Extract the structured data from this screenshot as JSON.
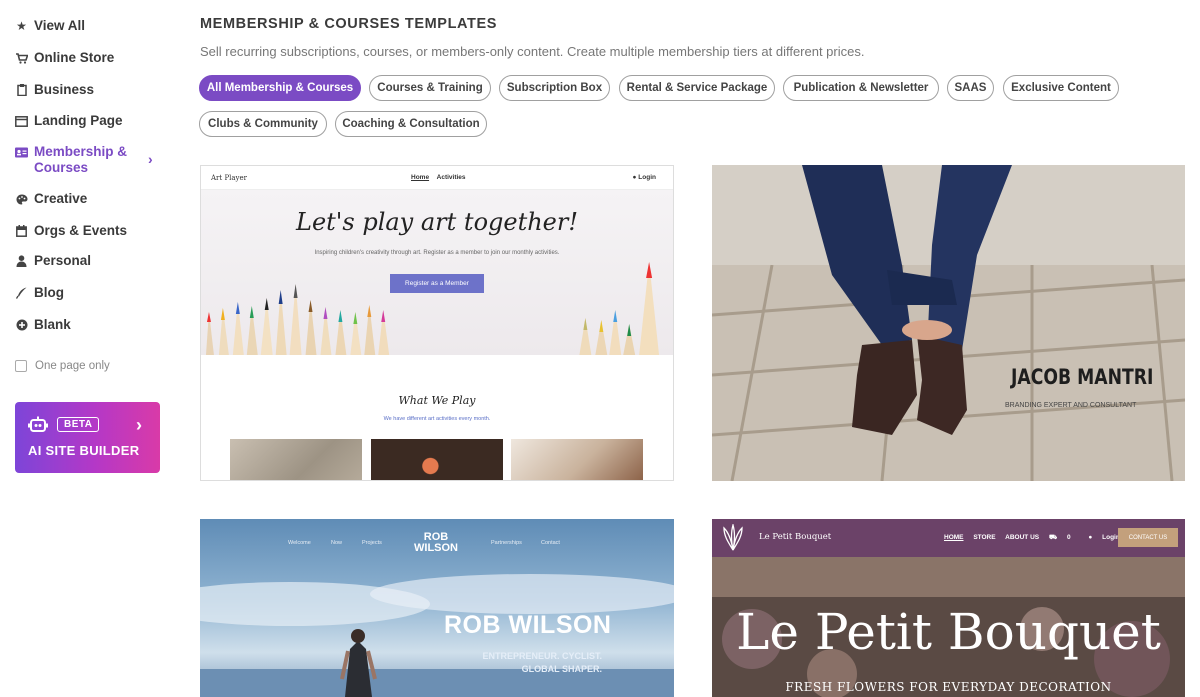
{
  "sidebar": {
    "items": [
      {
        "label": "View All",
        "icon": "star-icon"
      },
      {
        "label": "Online Store",
        "icon": "cart-icon"
      },
      {
        "label": "Business",
        "icon": "clipboard-icon"
      },
      {
        "label": "Landing Page",
        "icon": "browser-window-icon"
      },
      {
        "label": "Membership & Courses",
        "icon": "id-card-icon",
        "active": true
      },
      {
        "label": "Creative",
        "icon": "palette-icon"
      },
      {
        "label": "Orgs & Events",
        "icon": "calendar-icon"
      },
      {
        "label": "Personal",
        "icon": "person-icon"
      },
      {
        "label": "Blog",
        "icon": "quill-icon"
      },
      {
        "label": "Blank",
        "icon": "plus-circle-icon"
      }
    ],
    "one_page_only": "One page only",
    "ai_builder": {
      "badge": "BETA",
      "label": "AI SITE BUILDER"
    }
  },
  "main": {
    "title": "MEMBERSHIP & COURSES TEMPLATES",
    "subtitle": "Sell recurring subscriptions, courses, or members-only content. Create multiple membership tiers at different prices.",
    "filters": [
      "All Membership & Courses",
      "Courses & Training",
      "Subscription Box",
      "Rental & Service Package",
      "Publication & Newsletter",
      "SAAS",
      "Exclusive Content",
      "Clubs & Community",
      "Coaching & Consultation"
    ],
    "active_filter": "All Membership & Courses"
  },
  "templates": {
    "art": {
      "brand": "Art Player",
      "nav_home": "Home",
      "nav_activities": "Activities",
      "login": "Login",
      "headline": "Let's play art together!",
      "subtext": "Inspiring children's creativity through art. Register as a member to join our monthly activities.",
      "cta": "Register as a Member",
      "section_title": "What We Play",
      "section_sub": "We have different art activities every month."
    },
    "jacob": {
      "name": "JACOB MANTRI",
      "role": "BRANDING EXPERT AND CONSULTANT"
    },
    "rob": {
      "nav": [
        "Welcome",
        "Now",
        "Projects",
        "Partnerships",
        "Contact"
      ],
      "logo_line1": "ROB",
      "logo_line2": "WILSON",
      "name": "ROB WILSON",
      "tag_line1": "ENTREPRENEUR. CYCLIST.",
      "tag_line2": "GLOBAL SHAPER."
    },
    "bouquet": {
      "brand": "Le Petit Bouquet",
      "nav": [
        "HOME",
        "STORE",
        "ABOUT US",
        "0",
        "Login"
      ],
      "contact": "CONTACT US",
      "title": "Le Petit Bouquet",
      "subtitle": "FRESH FLOWERS FOR EVERYDAY DECORATION"
    }
  },
  "colors": {
    "accent": "#7b4bc4",
    "ai_gradient_start": "#7d45d8",
    "ai_gradient_end": "#d93aa8"
  }
}
